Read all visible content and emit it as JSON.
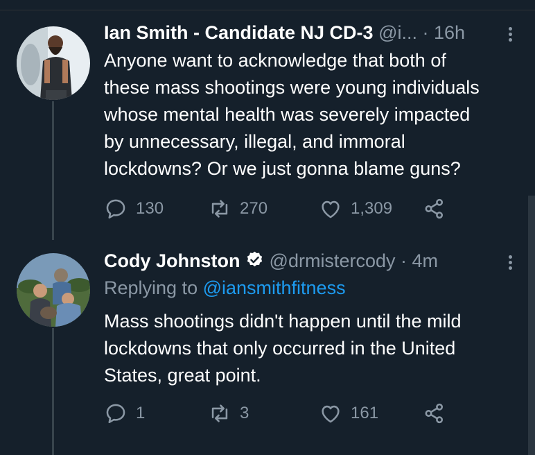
{
  "tweets": [
    {
      "author_name": "Ian Smith - Candidate NJ CD-3",
      "handle_meta": "@i...",
      "time": "· 16h",
      "text_lines": [
        "Anyone want to acknowledge that both of",
        "these mass shootings were young individuals",
        "whose mental health was severely impacted",
        "by unnecessary, illegal, and immoral",
        "lockdowns? Or we just gonna blame guns?"
      ],
      "replies": "130",
      "retweets": "270",
      "likes": "1,309"
    },
    {
      "author_name": "Cody Johnston",
      "handle_meta": "@drmistercody",
      "time": "· 4m",
      "replying_prefix": "Replying to ",
      "replying_handle": "@iansmithfitness",
      "text_lines": [
        "Mass shootings didn't happen until the mild",
        "lockdowns that only occurred in the United",
        "States, great point."
      ],
      "replies": "1",
      "retweets": "3",
      "likes": "161"
    }
  ],
  "colors": {
    "background": "#15202b",
    "muted": "#8b98a5",
    "link": "#1d9bf0",
    "verified": "#ffffff"
  },
  "icons": [
    "reply-icon",
    "retweet-icon",
    "like-icon",
    "share-icon",
    "more-icon",
    "verified-badge-icon"
  ]
}
